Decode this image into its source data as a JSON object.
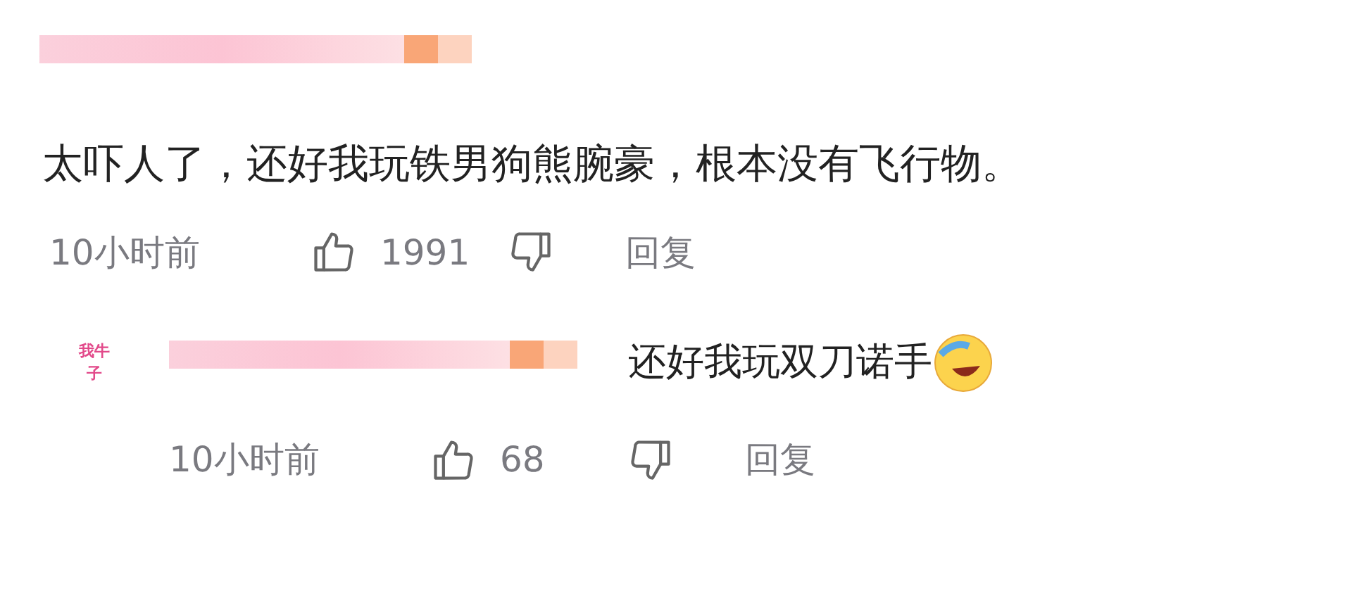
{
  "comment": {
    "text": "太吓人了，还好我玩铁男狗熊腕豪，根本没有飞行物。",
    "time": "10小时前",
    "likes": "1991",
    "reply_label": "回复"
  },
  "reply": {
    "avatar_lines": [
      "我牛",
      "子"
    ],
    "text": "还好我玩双刀诺手",
    "time": "10小时前",
    "likes": "68",
    "reply_label": "回复"
  }
}
